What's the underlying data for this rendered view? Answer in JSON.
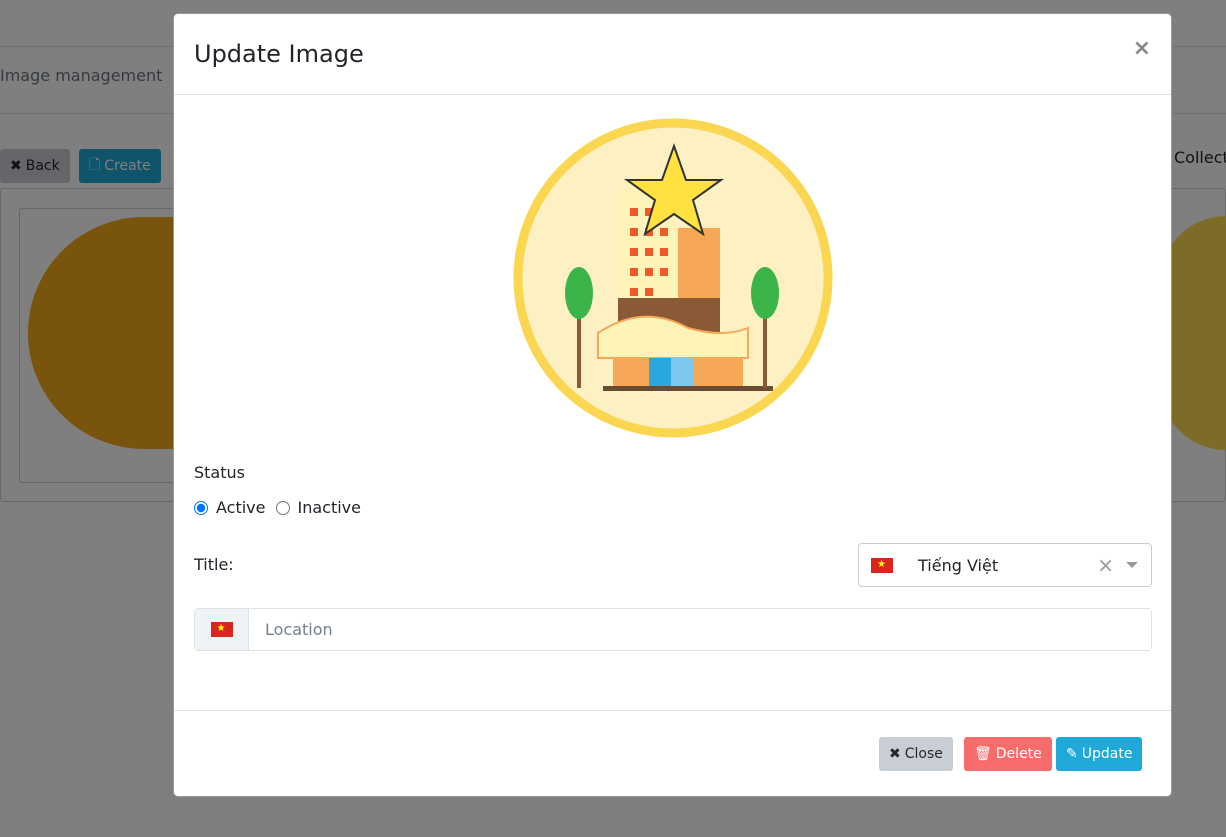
{
  "background": {
    "breadcrumb": "Image management",
    "back_label": "Back",
    "create_label": "Create",
    "collection_label": "Collect"
  },
  "modal": {
    "title": "Update Image",
    "close_icon": "×",
    "status_label": "Status",
    "status_options": [
      {
        "label": "Active",
        "checked": true
      },
      {
        "label": "Inactive",
        "checked": false
      }
    ],
    "title_label": "Title:",
    "language_select": {
      "value": "Tiếng Việt",
      "flag": "vietnam-flag",
      "clear": "×"
    },
    "title_input": {
      "value": "",
      "placeholder": "Location"
    },
    "footer": {
      "close_label": "Close",
      "delete_label": "Delete",
      "update_label": "Update"
    }
  },
  "colors": {
    "primary": "#20a8d8",
    "danger": "#f86c6b",
    "secondary": "#c8ced3"
  }
}
